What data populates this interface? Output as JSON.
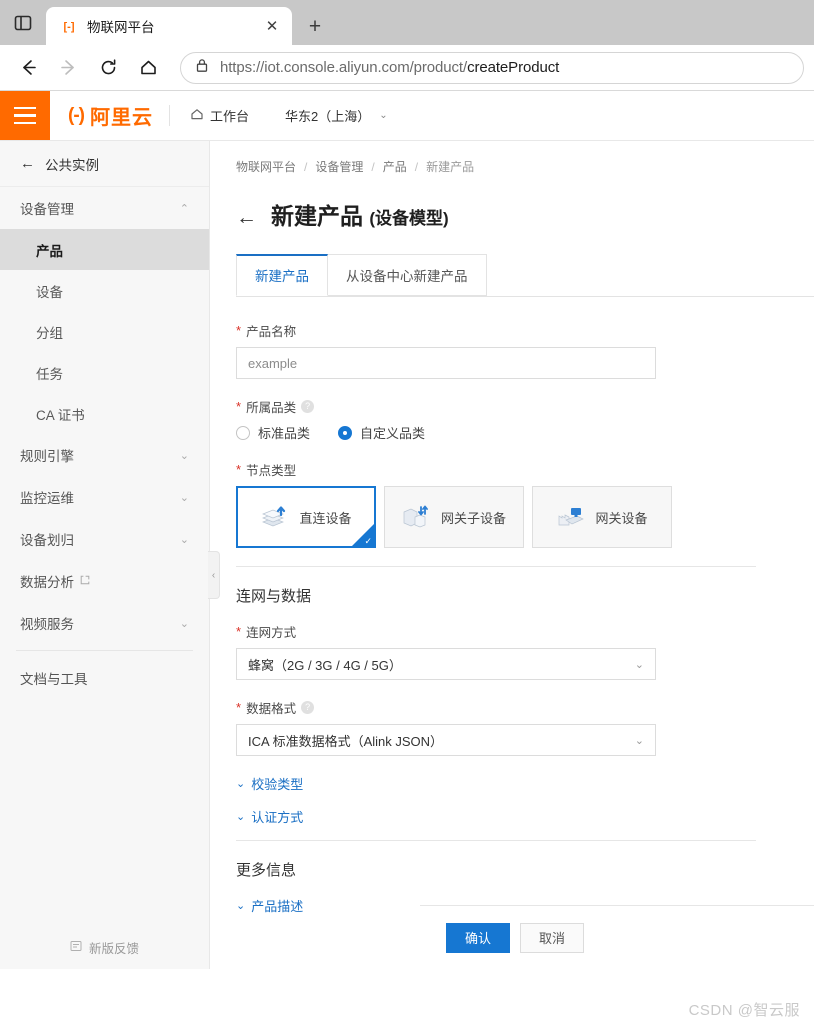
{
  "browser": {
    "sidebar_toggle_icon": "panel-icon",
    "tab": {
      "favicon": "aliyun-favicon",
      "title": "物联网平台",
      "close_label": "✕"
    },
    "new_tab_label": "+",
    "nav": {
      "back": "←",
      "forward": "→",
      "reload": "⟳",
      "home": "⌂"
    },
    "url_secure_icon": "lock-icon",
    "url_prefix": "https://iot.console.aliyun.com/product/",
    "url_highlight": "createProduct"
  },
  "header": {
    "menu_icon": "hamburger-icon",
    "brand_mark": "(-)",
    "brand_text": "阿里云",
    "workbench": {
      "icon": "home-icon",
      "label": "工作台"
    },
    "region": {
      "label": "华东2（上海）",
      "caret": "⌄"
    }
  },
  "sidebar": {
    "back": {
      "arrow": "←",
      "label": "公共实例"
    },
    "groups": [
      {
        "label": "设备管理",
        "chevron": "⌃",
        "expanded": true
      },
      {
        "label": "规则引擎",
        "chevron": "⌄",
        "expanded": false
      },
      {
        "label": "监控运维",
        "chevron": "⌄",
        "expanded": false
      },
      {
        "label": "设备划归",
        "chevron": "⌄",
        "expanded": false
      },
      {
        "label": "视频服务",
        "chevron": "⌄",
        "expanded": false
      }
    ],
    "device_items": [
      {
        "label": "产品",
        "active": true
      },
      {
        "label": "设备",
        "active": false
      },
      {
        "label": "分组",
        "active": false
      },
      {
        "label": "任务",
        "active": false
      },
      {
        "label": "CA 证书",
        "active": false
      }
    ],
    "data_analysis": {
      "label": "数据分析",
      "external_icon": "external-link-icon"
    },
    "docs": {
      "label": "文档与工具"
    },
    "feedback": {
      "icon": "feedback-icon",
      "label": "新版反馈"
    },
    "collapse_handle": "‹"
  },
  "main": {
    "breadcrumb": [
      "物联网平台",
      "设备管理",
      "产品",
      "新建产品"
    ],
    "breadcrumb_separator": "/",
    "back_arrow": "←",
    "title": "新建产品",
    "title_suffix": "(设备模型)",
    "tabs": [
      {
        "label": "新建产品",
        "active": true
      },
      {
        "label": "从设备中心新建产品",
        "active": false
      }
    ],
    "fields": {
      "product_name": {
        "required_mark": "*",
        "label": "产品名称",
        "value": "example"
      },
      "category": {
        "required_mark": "*",
        "label": "所属品类",
        "help_icon": "question-icon",
        "options": [
          {
            "label": "标准品类",
            "checked": false
          },
          {
            "label": "自定义品类",
            "checked": true
          }
        ]
      },
      "node_type": {
        "required_mark": "*",
        "label": "节点类型",
        "cards": [
          {
            "label": "直连设备",
            "icon": "direct-device-icon",
            "selected": true,
            "check": "✓"
          },
          {
            "label": "网关子设备",
            "icon": "gateway-subdevice-icon",
            "selected": false
          },
          {
            "label": "网关设备",
            "icon": "gateway-device-icon",
            "selected": false
          }
        ]
      }
    },
    "network_section": {
      "title": "连网与数据",
      "network_mode": {
        "required_mark": "*",
        "label": "连网方式",
        "value": "蜂窝（2G / 3G / 4G / 5G）",
        "caret": "⌄"
      },
      "data_format": {
        "required_mark": "*",
        "label": "数据格式",
        "help_icon": "question-icon",
        "value": "ICA 标准数据格式（Alink JSON）",
        "caret": "⌄"
      },
      "collapsibles": [
        {
          "label": "校验类型",
          "chevron": "⌄"
        },
        {
          "label": "认证方式",
          "chevron": "⌄"
        }
      ]
    },
    "more_section": {
      "title": "更多信息",
      "collapsibles": [
        {
          "label": "产品描述",
          "chevron": "⌄"
        }
      ]
    },
    "footer": {
      "confirm": "确认",
      "cancel": "取消"
    },
    "watermark": "CSDN @智云服"
  },
  "colors": {
    "accent_orange": "#ff6a00",
    "primary_blue": "#1677d2",
    "link_blue": "#1a6fc4",
    "required_red": "#d93026"
  }
}
